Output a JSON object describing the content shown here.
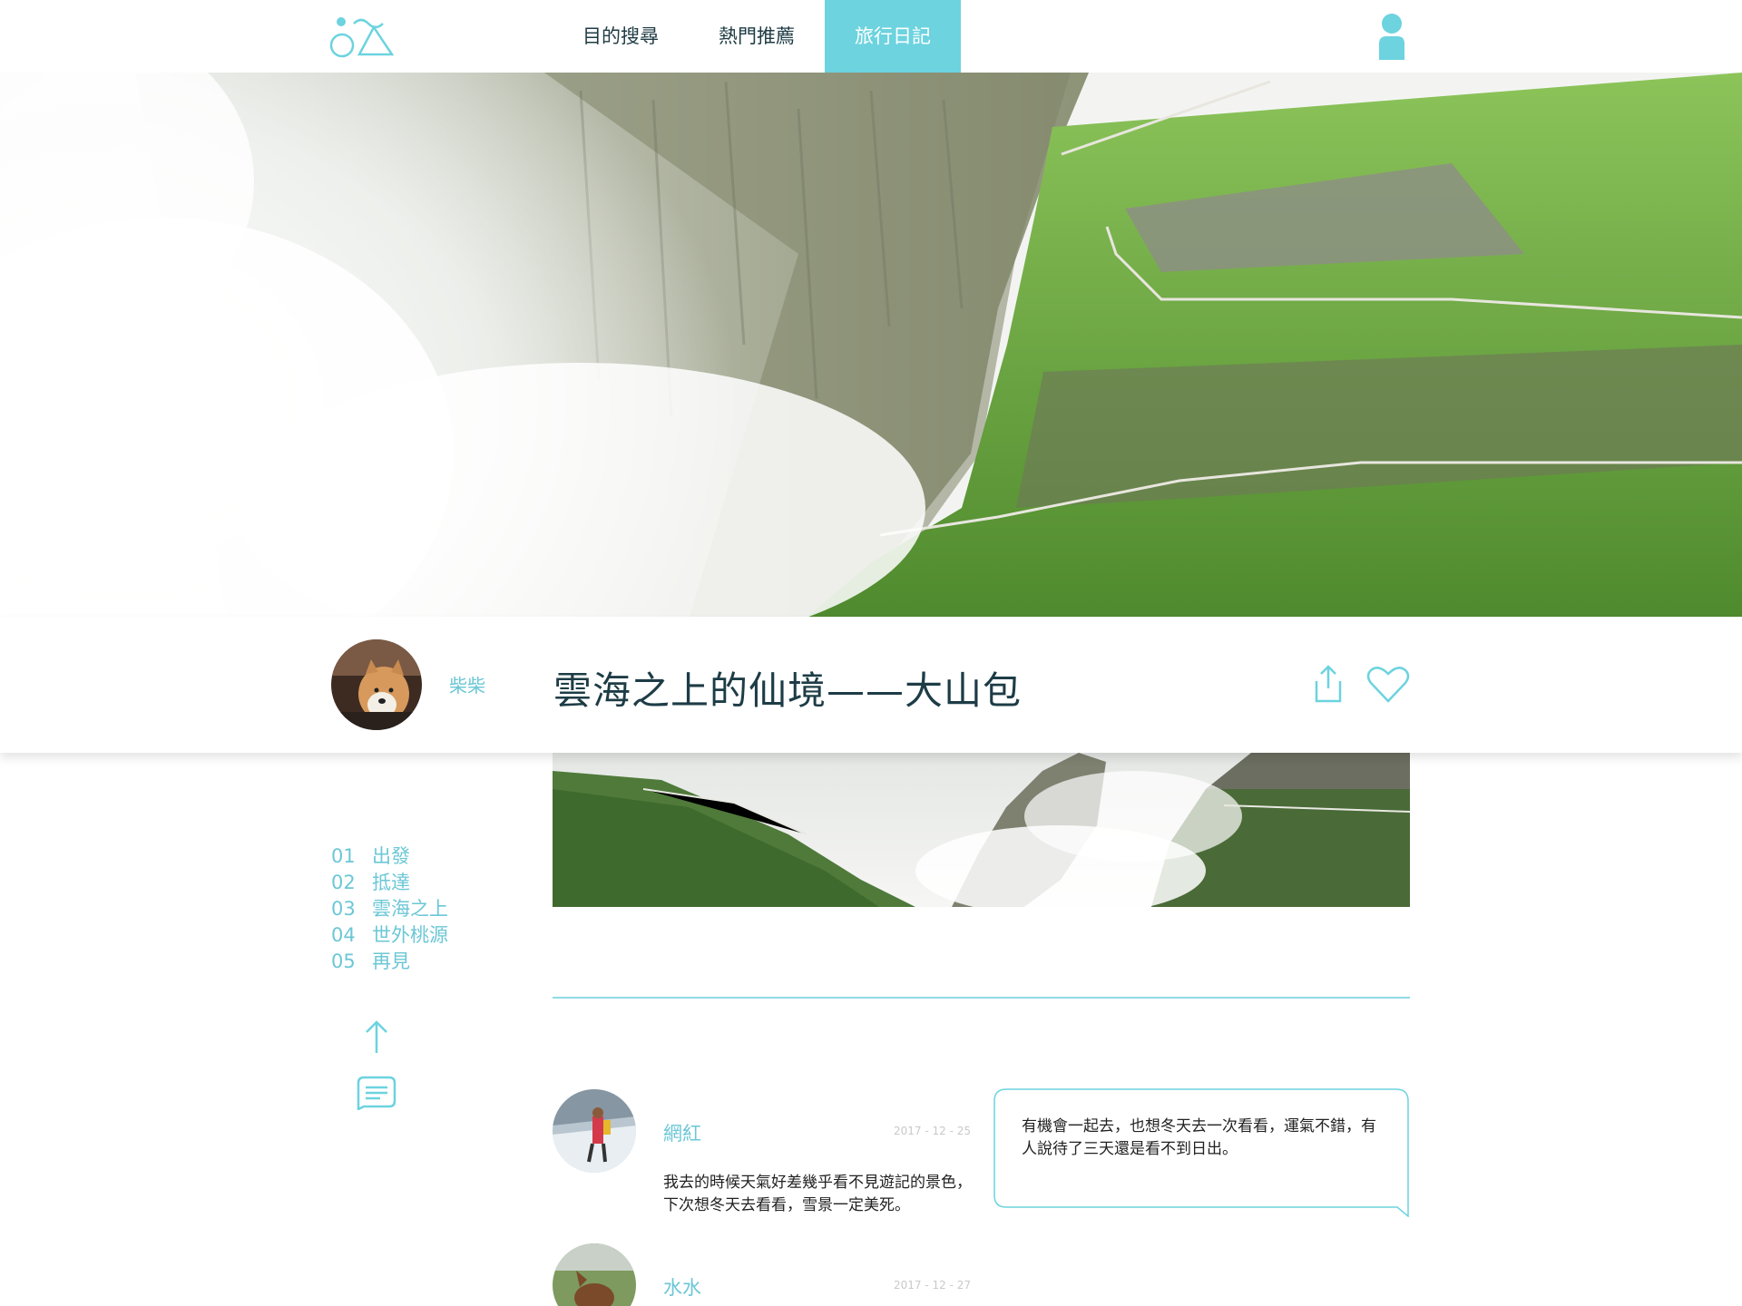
{
  "nav": {
    "items": [
      {
        "label": "目的搜尋"
      },
      {
        "label": "熱門推薦"
      },
      {
        "label": "旅行日記"
      }
    ]
  },
  "article": {
    "author": "柴柴",
    "title": "雲海之上的仙境——大山包"
  },
  "toc": [
    {
      "num": "01",
      "label": "出發"
    },
    {
      "num": "02",
      "label": "抵達"
    },
    {
      "num": "03",
      "label": "雲海之上"
    },
    {
      "num": "04",
      "label": "世外桃源"
    },
    {
      "num": "05",
      "label": "再見"
    }
  ],
  "comments": [
    {
      "name": "網紅",
      "date": "2017 - 12 - 25",
      "text": "我去的時候天氣好差幾乎看不見遊記的景色，下次想冬天去看看，雪景一定美死。"
    },
    {
      "name": "水水",
      "date": "2017 - 12 - 27"
    }
  ],
  "reply": {
    "text": "有機會一起去，也想冬天去一次看看，運氣不錯，有人說待了三天還是看不到日出。"
  },
  "colors": {
    "accent": "#6cd3df",
    "accent_text": "#6cc7d6",
    "title_text": "#1d3c46"
  }
}
